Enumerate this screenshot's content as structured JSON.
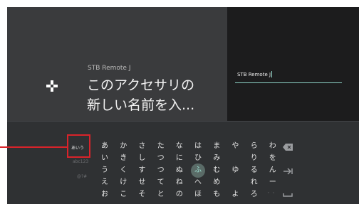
{
  "header": {
    "subtitle": "STB Remote J",
    "title_line1": "このアクセサリの",
    "title_line2": "新しい名前を入..."
  },
  "name_input": {
    "value": "STB Remote J"
  },
  "keyboard": {
    "modes": [
      "あいう",
      "abc123",
      "@?#"
    ],
    "active_mode": "あいう",
    "rows": [
      [
        "あ",
        "か",
        "さ",
        "た",
        "な",
        "は",
        "ま",
        "や",
        "ら",
        "わ"
      ],
      [
        "い",
        "き",
        "し",
        "つ",
        "に",
        "ひ",
        "み",
        "",
        "り",
        "を"
      ],
      [
        "う",
        "く",
        "す",
        "つ",
        "ぬ",
        "ふ",
        "む",
        "ゆ",
        "る",
        "ん"
      ],
      [
        "え",
        "け",
        "せ",
        "て",
        "ね",
        "へ",
        "め",
        "",
        "れ",
        "ー"
      ],
      [
        "お",
        "こ",
        "そ",
        "と",
        "の",
        "ほ",
        "も",
        "よ",
        "ろ",
        "゛゜"
      ]
    ],
    "focused_key": "ふ",
    "side_keys": [
      "backspace-icon",
      "next-icon",
      "space-icon"
    ]
  },
  "colors": {
    "accent": "#8fd5c8",
    "highlight": "#d9232a"
  }
}
